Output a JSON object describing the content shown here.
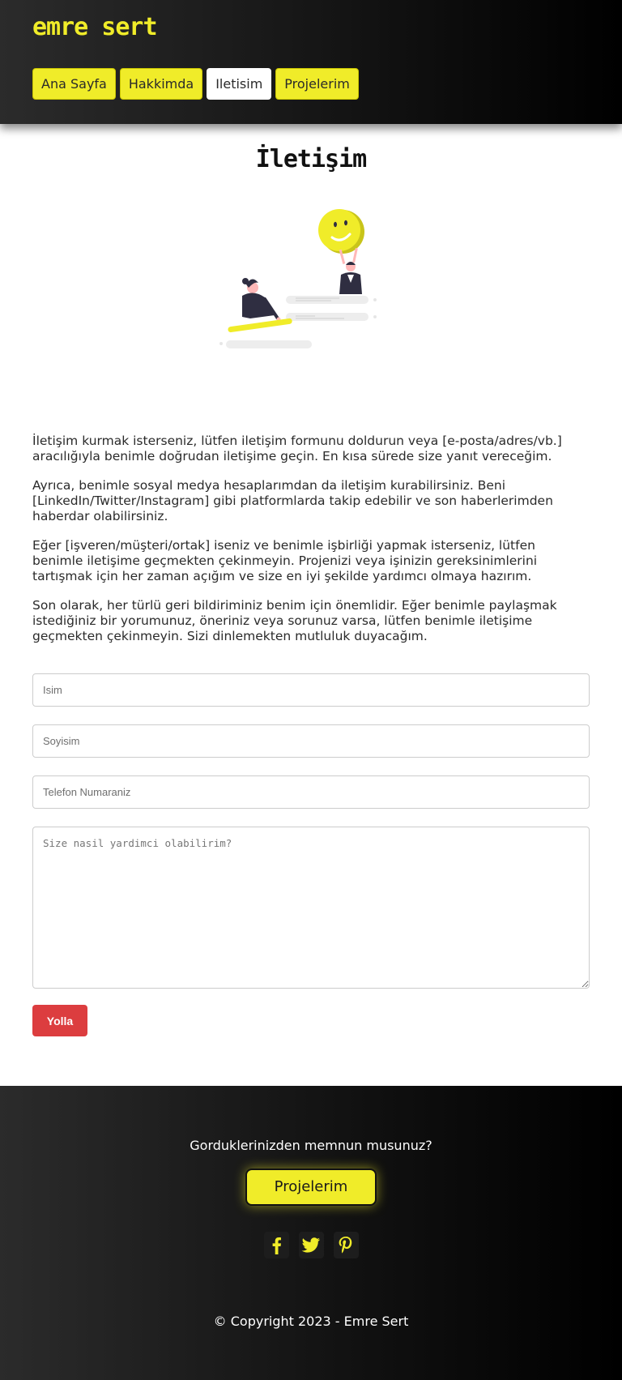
{
  "header": {
    "brand": "emre sert",
    "nav": [
      {
        "label": "Ana Sayfa",
        "active": false
      },
      {
        "label": "Hakkimda",
        "active": false
      },
      {
        "label": "Iletisim",
        "active": true
      },
      {
        "label": "Projelerim",
        "active": false
      }
    ]
  },
  "main": {
    "title": "İletişim",
    "paragraphs": [
      "İletişim kurmak isterseniz, lütfen iletişim formunu doldurun veya [e-posta/adres/vb.] aracılığıyla benimle doğrudan iletişime geçin. En kısa sürede size yanıt vereceğim.",
      "Ayrıca, benimle sosyal medya hesaplarımdan da iletişim kurabilirsiniz. Beni [LinkedIn/Twitter/Instagram] gibi platformlarda takip edebilir ve son haberlerimden haberdar olabilirsiniz.",
      "Eğer [işveren/müşteri/ortak] iseniz ve benimle işbirliği yapmak isterseniz, lütfen benimle iletişime geçmekten çekinmeyin. Projenizi veya işinizin gereksinimlerini tartışmak için her zaman açığım ve size en iyi şekilde yardımcı olmaya hazırım.",
      "Son olarak, her türlü geri bildiriminiz benim için önemlidir. Eğer benimle paylaşmak istediğiniz bir yorumunuz, öneriniz veya sorunuz varsa, lütfen benimle iletişime geçmekten çekinmeyin. Sizi dinlemekten mutluluk duyacağım."
    ]
  },
  "form": {
    "first_name_placeholder": "Isim",
    "last_name_placeholder": "Soyisim",
    "phone_placeholder": "Telefon Numaraniz",
    "message_placeholder": "Size nasil yardimci olabilirim?",
    "submit_label": "Yolla"
  },
  "footer": {
    "question": "Gorduklerinizden memnun musunuz?",
    "cta_label": "Projelerim",
    "socials": [
      {
        "icon": "facebook-icon"
      },
      {
        "icon": "twitter-icon"
      },
      {
        "icon": "pinterest-icon"
      }
    ],
    "copyright": "© Copyright 2023 - Emre Sert"
  },
  "colors": {
    "accent_yellow": "#f0ec29",
    "submit_red": "#dc3d3f",
    "dark": "#000000"
  }
}
